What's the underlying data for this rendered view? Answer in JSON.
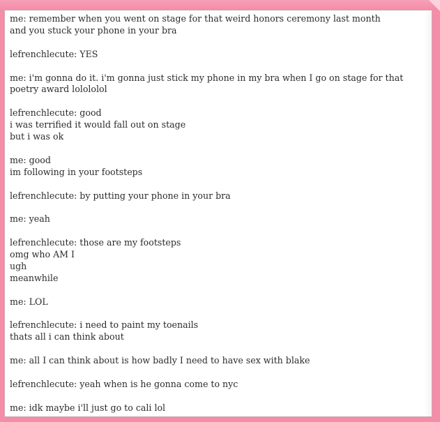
{
  "chat": {
    "messages": [
      {
        "lines": [
          "me: remember when you went on stage for that weird honors ceremony last month",
          "and you stuck your phone in your bra"
        ]
      },
      {
        "lines": [
          "lefrenchlecute: YES"
        ]
      },
      {
        "lines": [
          "me: i'm gonna do it. i'm gonna just stick my phone in my bra when I go on stage for that poetry award lolololol"
        ]
      },
      {
        "lines": [
          "lefrenchlecute: good",
          "i was terrified it would fall out on stage",
          "but i was ok"
        ]
      },
      {
        "lines": [
          "me: good",
          "im following in your footsteps"
        ]
      },
      {
        "lines": [
          "lefrenchlecute: by putting your phone in your bra"
        ]
      },
      {
        "lines": [
          "me: yeah"
        ]
      },
      {
        "lines": [
          "lefrenchlecute: those are my footsteps",
          "omg who AM I",
          "ugh",
          "meanwhile"
        ]
      },
      {
        "lines": [
          "me: LOL"
        ]
      },
      {
        "lines": [
          "lefrenchlecute: i need to paint my toenails",
          "thats all i can think about"
        ]
      },
      {
        "lines": [
          "me: all I can think about is how badly I need to have sex with blake"
        ]
      },
      {
        "lines": [
          "lefrenchlecute: yeah when is he gonna come to nyc"
        ]
      },
      {
        "lines": [
          "me: idk maybe i'll just go to cali lol"
        ]
      }
    ]
  },
  "colors": {
    "frame": "#f58ca8",
    "panel": "#ffffff",
    "text": "#2b2b2b"
  }
}
